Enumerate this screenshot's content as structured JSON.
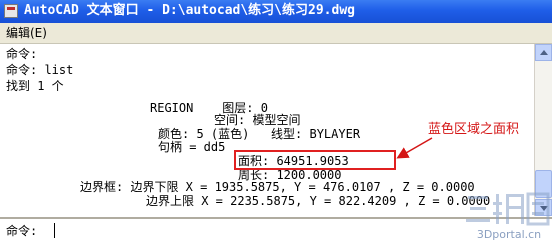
{
  "window": {
    "title": "AutoCAD 文本窗口 - D:\\autocad\\练习\\练习29.dwg"
  },
  "menu": {
    "edit": "编辑(E)"
  },
  "history": {
    "lines": [
      "命令:",
      "命令: list",
      "找到 1 个",
      "REGION    图层: 0",
      "空间: 模型空间",
      "颜色: 5 (蓝色)   线型: BYLAYER",
      "句柄 = dd5",
      "面积: 64951.9053",
      "周长: 1200.0000",
      "边界框: 边界下限 X = 1935.5875, Y = 476.0107 , Z = 0.0000",
      "边界上限 X = 2235.5875, Y = 822.4209 , Z = 0.0000"
    ]
  },
  "command_line": {
    "prompt": "命令:"
  },
  "annotation": {
    "text": "蓝色区域之面积",
    "color": "#d41616"
  },
  "watermark": {
    "logo_text": "三维网",
    "site": "3Dportal.cn"
  },
  "colors": {
    "titlebar": "#1f5ee8",
    "highlight": "#e02020"
  }
}
